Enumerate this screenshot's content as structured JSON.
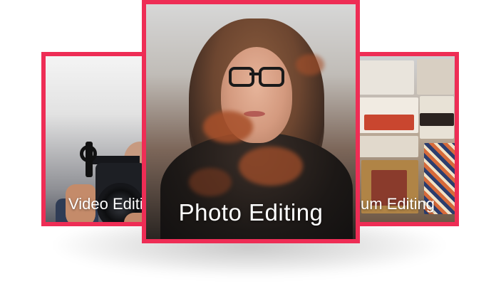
{
  "cards": {
    "left": {
      "label": "Video Editing"
    },
    "middle": {
      "label": "Photo Editing"
    },
    "right": {
      "label": "Album Editing"
    }
  },
  "colors": {
    "accent": "#ee2d55"
  }
}
